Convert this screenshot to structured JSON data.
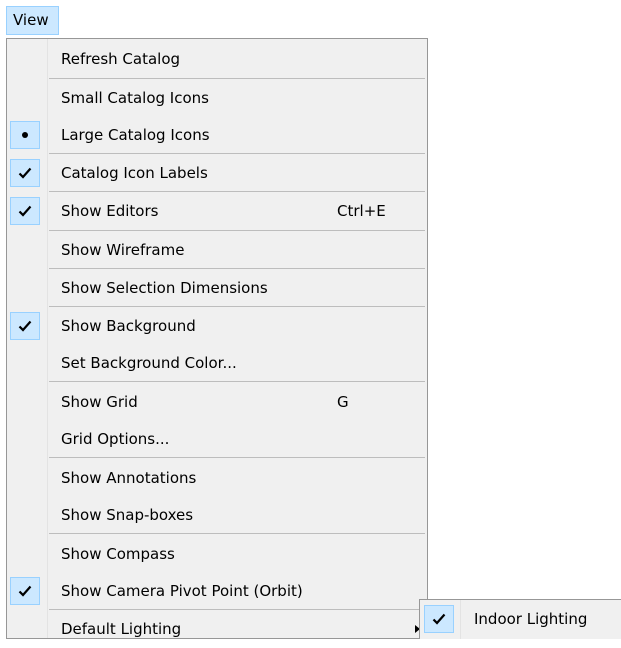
{
  "menubar": {
    "view_label": "View"
  },
  "menu": {
    "items": [
      {
        "label": "Refresh Catalog"
      },
      {
        "label": "Small Catalog Icons"
      },
      {
        "label": "Large Catalog Icons",
        "mark": "radio-dot"
      },
      {
        "label": "Catalog Icon Labels",
        "mark": "checkmark"
      },
      {
        "label": "Show Editors",
        "shortcut": "Ctrl+E",
        "mark": "checkmark"
      },
      {
        "label": "Show Wireframe"
      },
      {
        "label": "Show Selection Dimensions"
      },
      {
        "label": "Show Background",
        "mark": "checkmark"
      },
      {
        "label": "Set Background Color..."
      },
      {
        "label": "Show Grid",
        "shortcut": "G"
      },
      {
        "label": "Grid Options..."
      },
      {
        "label": "Show Annotations"
      },
      {
        "label": "Show Snap-boxes"
      },
      {
        "label": "Show Compass"
      },
      {
        "label": "Show Camera Pivot Point (Orbit)",
        "mark": "checkmark"
      },
      {
        "label": "Default Lighting",
        "submenu": true
      }
    ]
  },
  "submenu": {
    "items": [
      {
        "label": "Indoor Lighting",
        "mark": "checkmark"
      }
    ]
  },
  "colors": {
    "menu_background": "#f0f0f0",
    "highlight_background": "#cce8ff",
    "highlight_border": "#99d1ff",
    "separator": "#bdbdbd",
    "menu_border": "#979797"
  },
  "icons": {
    "check": "checkmark-icon",
    "radio": "radio-dot-icon",
    "submenu": "submenu-arrow-icon"
  }
}
